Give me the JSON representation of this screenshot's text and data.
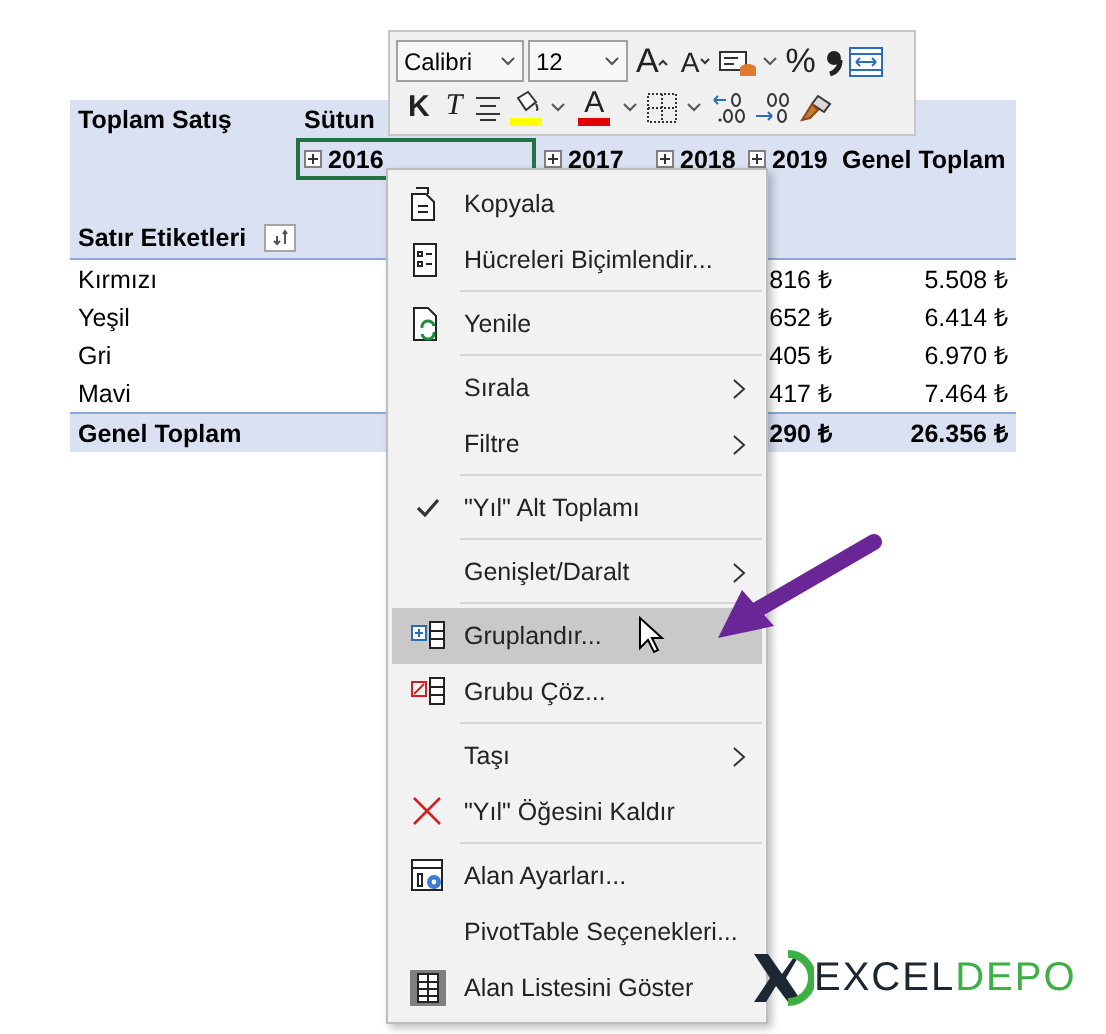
{
  "pivot": {
    "value_label": "Toplam Satış",
    "column_label": "Sütun",
    "row_label": "Satır Etiketleri",
    "columns": [
      {
        "label": "2016",
        "expandable": true,
        "selected": true
      },
      {
        "label": "2017",
        "expandable": true,
        "selected": false
      },
      {
        "label": "2018",
        "expandable": true,
        "selected": false
      },
      {
        "label": "2019",
        "expandable": true,
        "selected": false
      },
      {
        "label": "Genel Toplam",
        "expandable": false,
        "selected": false
      }
    ],
    "rows": [
      {
        "label": "Kırmızı",
        "partial_value": "816 ₺",
        "total": "5.508 ₺"
      },
      {
        "label": "Yeşil",
        "partial_value": "652 ₺",
        "total": "6.414 ₺"
      },
      {
        "label": "Gri",
        "partial_value": "405 ₺",
        "total": "6.970 ₺"
      },
      {
        "label": "Mavi",
        "partial_value": "417 ₺",
        "total": "7.464 ₺"
      }
    ],
    "grand_total": {
      "label": "Genel Toplam",
      "partial_value": "290 ₺",
      "total": "26.356 ₺"
    }
  },
  "toolbar": {
    "font": "Calibri",
    "size": "12",
    "grow": "A",
    "shrink": "A",
    "percent": "%",
    "bold": "K",
    "italic": "T",
    "font_color": "A"
  },
  "menu": {
    "items": [
      {
        "kind": "command",
        "label": "Kopyala",
        "submenu": false,
        "checked": false,
        "selected": false
      },
      {
        "kind": "command",
        "label": "Hücreleri Biçimlendir...",
        "submenu": false,
        "checked": false,
        "selected": false
      },
      {
        "kind": "separator"
      },
      {
        "kind": "command",
        "label": "Yenile",
        "submenu": false,
        "checked": false,
        "selected": false
      },
      {
        "kind": "separator"
      },
      {
        "kind": "command",
        "label": "Sırala",
        "submenu": true,
        "checked": false,
        "selected": false
      },
      {
        "kind": "command",
        "label": "Filtre",
        "submenu": true,
        "checked": false,
        "selected": false
      },
      {
        "kind": "separator"
      },
      {
        "kind": "command",
        "label": "\"Yıl\" Alt Toplamı",
        "submenu": false,
        "checked": true,
        "selected": false
      },
      {
        "kind": "separator"
      },
      {
        "kind": "command",
        "label": "Genişlet/Daralt",
        "submenu": true,
        "checked": false,
        "selected": false
      },
      {
        "kind": "separator"
      },
      {
        "kind": "command",
        "label": "Gruplandır...",
        "submenu": false,
        "checked": false,
        "selected": true
      },
      {
        "kind": "command",
        "label": "Grubu Çöz...",
        "submenu": false,
        "checked": false,
        "selected": false
      },
      {
        "kind": "separator"
      },
      {
        "kind": "command",
        "label": "Taşı",
        "submenu": true,
        "checked": false,
        "selected": false
      },
      {
        "kind": "command",
        "label": "\"Yıl\" Öğesini Kaldır",
        "submenu": false,
        "checked": false,
        "selected": false
      },
      {
        "kind": "separator"
      },
      {
        "kind": "command",
        "label": "Alan Ayarları...",
        "submenu": false,
        "checked": false,
        "selected": false
      },
      {
        "kind": "command",
        "label": "PivotTable Seçenekleri...",
        "submenu": false,
        "checked": false,
        "selected": false
      },
      {
        "kind": "command",
        "label": "Alan Listesini Göster",
        "submenu": false,
        "checked": false,
        "selected": false
      }
    ]
  },
  "logo": {
    "dark_text": "EXCEL",
    "green_text": "DEPO"
  }
}
